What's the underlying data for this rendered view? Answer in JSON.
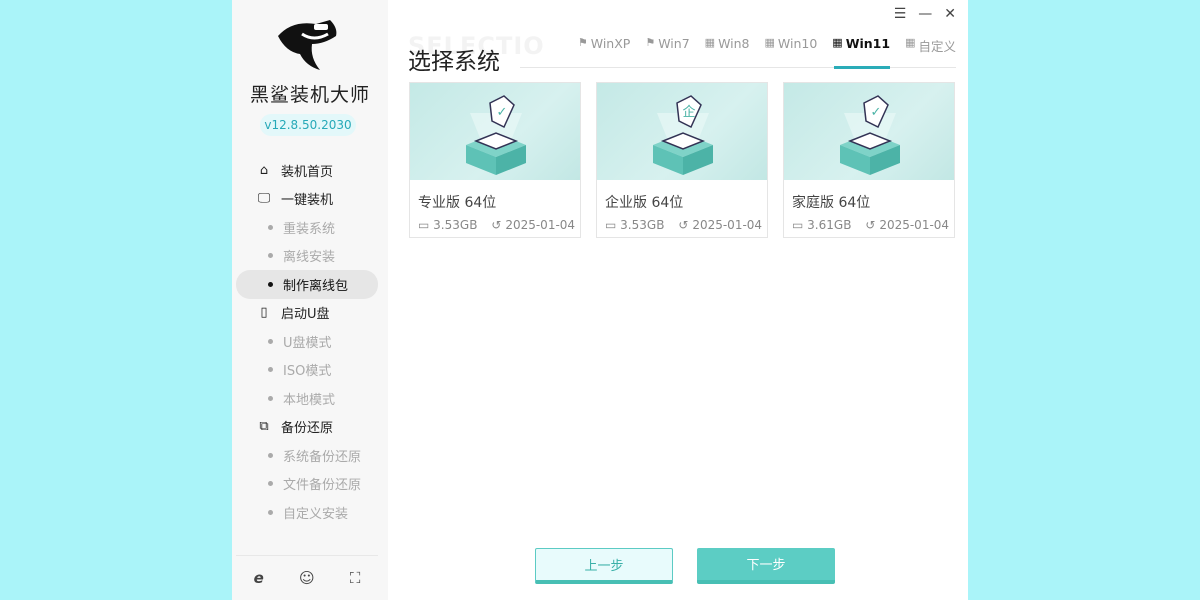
{
  "app": {
    "name": "黑鲨装机大师",
    "version": "v12.8.50.2030"
  },
  "sidebar": {
    "items": [
      {
        "label": "装机首页",
        "type": "main",
        "icon": "home-icon"
      },
      {
        "label": "一键装机",
        "type": "main",
        "icon": "monitor-icon"
      },
      {
        "label": "重装系统",
        "type": "sub"
      },
      {
        "label": "离线安装",
        "type": "sub"
      },
      {
        "label": "制作离线包",
        "type": "sub",
        "active": true
      },
      {
        "label": "启动U盘",
        "type": "main",
        "icon": "usb-icon"
      },
      {
        "label": "U盘模式",
        "type": "sub"
      },
      {
        "label": "ISO模式",
        "type": "sub"
      },
      {
        "label": "本地模式",
        "type": "sub"
      },
      {
        "label": "备份还原",
        "type": "main",
        "icon": "backup-icon"
      },
      {
        "label": "系统备份还原",
        "type": "sub"
      },
      {
        "label": "文件备份还原",
        "type": "sub"
      },
      {
        "label": "自定义安装",
        "type": "sub"
      }
    ]
  },
  "main": {
    "watermark": "SELECTIO",
    "title": "选择系统",
    "tabs": [
      {
        "label": "WinXP"
      },
      {
        "label": "Win7"
      },
      {
        "label": "Win8"
      },
      {
        "label": "Win10"
      },
      {
        "label": "Win11",
        "active": true
      },
      {
        "label": "自定义"
      }
    ],
    "cards": [
      {
        "name": "专业版 64位",
        "size": "3.53GB",
        "date": "2025-01-04",
        "badge": "✓"
      },
      {
        "name": "企业版 64位",
        "size": "3.53GB",
        "date": "2025-01-04",
        "badge": "企"
      },
      {
        "name": "家庭版 64位",
        "size": "3.61GB",
        "date": "2025-01-04",
        "badge": "✓"
      }
    ],
    "prev_label": "上一步",
    "next_label": "下一步"
  },
  "colors": {
    "accent": "#2aacb8",
    "button": "#5ccdc4",
    "background": "#aaf4f9"
  }
}
